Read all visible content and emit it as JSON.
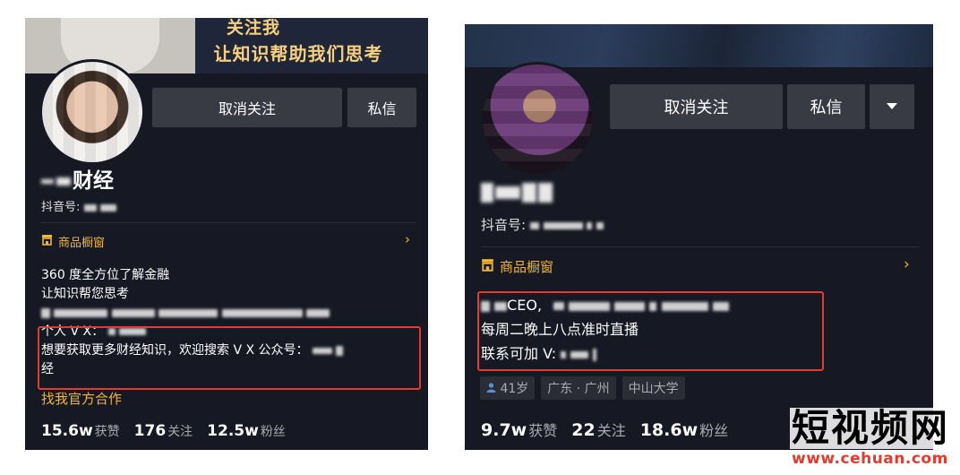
{
  "left_profile": {
    "banner": {
      "line1": "关注我",
      "line2": "让知识帮助我们思考"
    },
    "unfollow_label": "取消关注",
    "message_label": "私信",
    "name_suffix": "财经",
    "douyin_prefix": "抖音号:",
    "shop_label": "商品橱窗",
    "bio": {
      "line1": "360 度全方位了解金融",
      "line2": "让知识帮您思考",
      "line4": "个人 V X：",
      "line5": "想要获取更多财经知识，欢迎搜索 V X 公众号：",
      "line6": "经"
    },
    "collab_label": "找我官方合作",
    "stats": [
      {
        "value": "15.6w",
        "label": "获赞"
      },
      {
        "value": "176",
        "label": "关注"
      },
      {
        "value": "12.5w",
        "label": "粉丝"
      }
    ]
  },
  "right_profile": {
    "unfollow_label": "取消关注",
    "message_label": "私信",
    "more_icon": "caret-down-icon",
    "douyin_prefix": "抖音号:",
    "shop_label": "商品橱窗",
    "bio": {
      "line1_mid": "CEO,",
      "line2": "每周二晚上八点准时直播",
      "line3": "联系可加 V:"
    },
    "tags": [
      "41岁",
      "广东 · 广州",
      "中山大学"
    ],
    "stats": [
      {
        "value": "9.7w",
        "label": "获赞"
      },
      {
        "value": "22",
        "label": "关注"
      },
      {
        "value": "18.6w",
        "label": "粉丝"
      }
    ]
  },
  "watermark": {
    "title": "短视频网",
    "url": "www.cehuan.com"
  },
  "colors": {
    "panel_bg": "#161823",
    "accent_gold": "#f2b630",
    "highlight_red": "#e33b2e",
    "button_bg": "#393b44"
  }
}
